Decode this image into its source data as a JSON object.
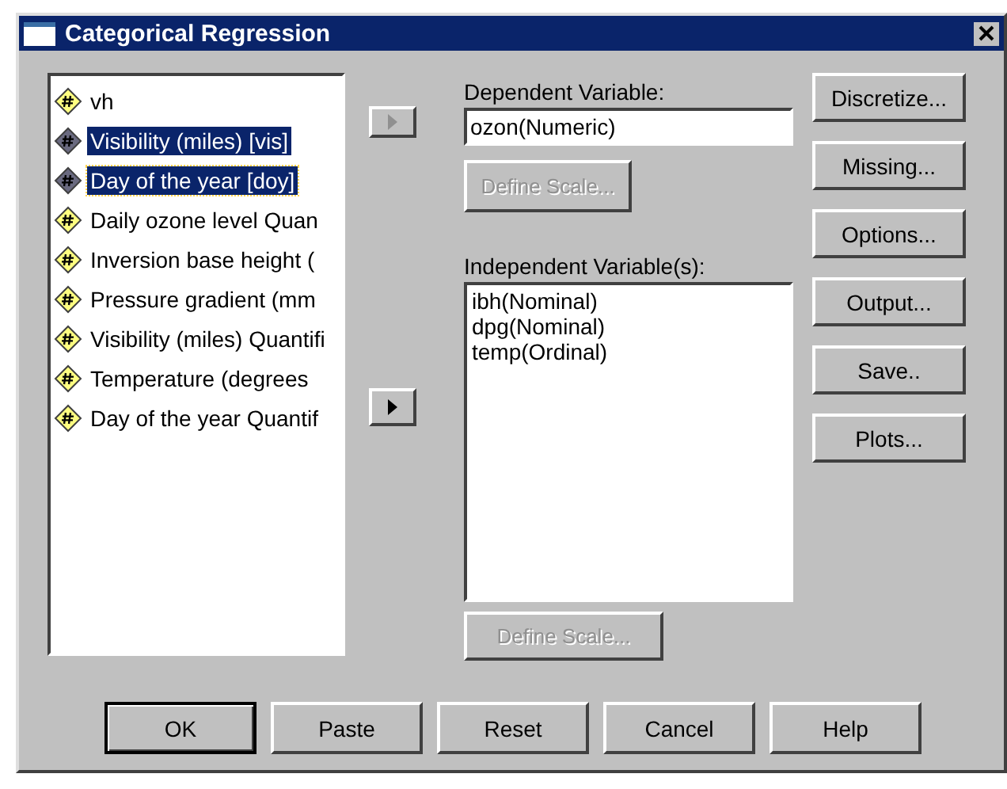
{
  "window": {
    "title": "Categorical Regression"
  },
  "source_variables": [
    {
      "label": "vh",
      "selected": false,
      "focused": false
    },
    {
      "label": "Visibility (miles) [vis]",
      "selected": true,
      "focused": false
    },
    {
      "label": "Day of the year [doy]",
      "selected": true,
      "focused": true
    },
    {
      "label": "Daily ozone level Quan",
      "selected": false,
      "focused": false
    },
    {
      "label": "Inversion base height (",
      "selected": false,
      "focused": false
    },
    {
      "label": "Pressure gradient (mm",
      "selected": false,
      "focused": false
    },
    {
      "label": "Visibility (miles) Quantifi",
      "selected": false,
      "focused": false
    },
    {
      "label": "Temperature (degrees",
      "selected": false,
      "focused": false
    },
    {
      "label": "Day of the year Quantif",
      "selected": false,
      "focused": false
    }
  ],
  "move_buttons": [
    {
      "disabled": true
    },
    {
      "disabled": false
    }
  ],
  "dependent": {
    "label": "Dependent Variable:",
    "value": "ozon(Numeric)",
    "define_scale": {
      "label": "Define Scale...",
      "disabled": true
    }
  },
  "independent": {
    "label": "Independent Variable(s):",
    "items": [
      "ibh(Nominal)",
      "dpg(Nominal)",
      "temp(Ordinal)"
    ],
    "define_scale": {
      "label": "Define Scale...",
      "disabled": true
    }
  },
  "side_buttons": [
    "Discretize...",
    "Missing...",
    "Options...",
    "Output...",
    "Save..",
    "Plots..."
  ],
  "bottom_buttons": [
    {
      "label": "OK",
      "default": true
    },
    {
      "label": "Paste",
      "default": false
    },
    {
      "label": "Reset",
      "default": false
    },
    {
      "label": "Cancel",
      "default": false
    },
    {
      "label": "Help",
      "default": false
    }
  ]
}
